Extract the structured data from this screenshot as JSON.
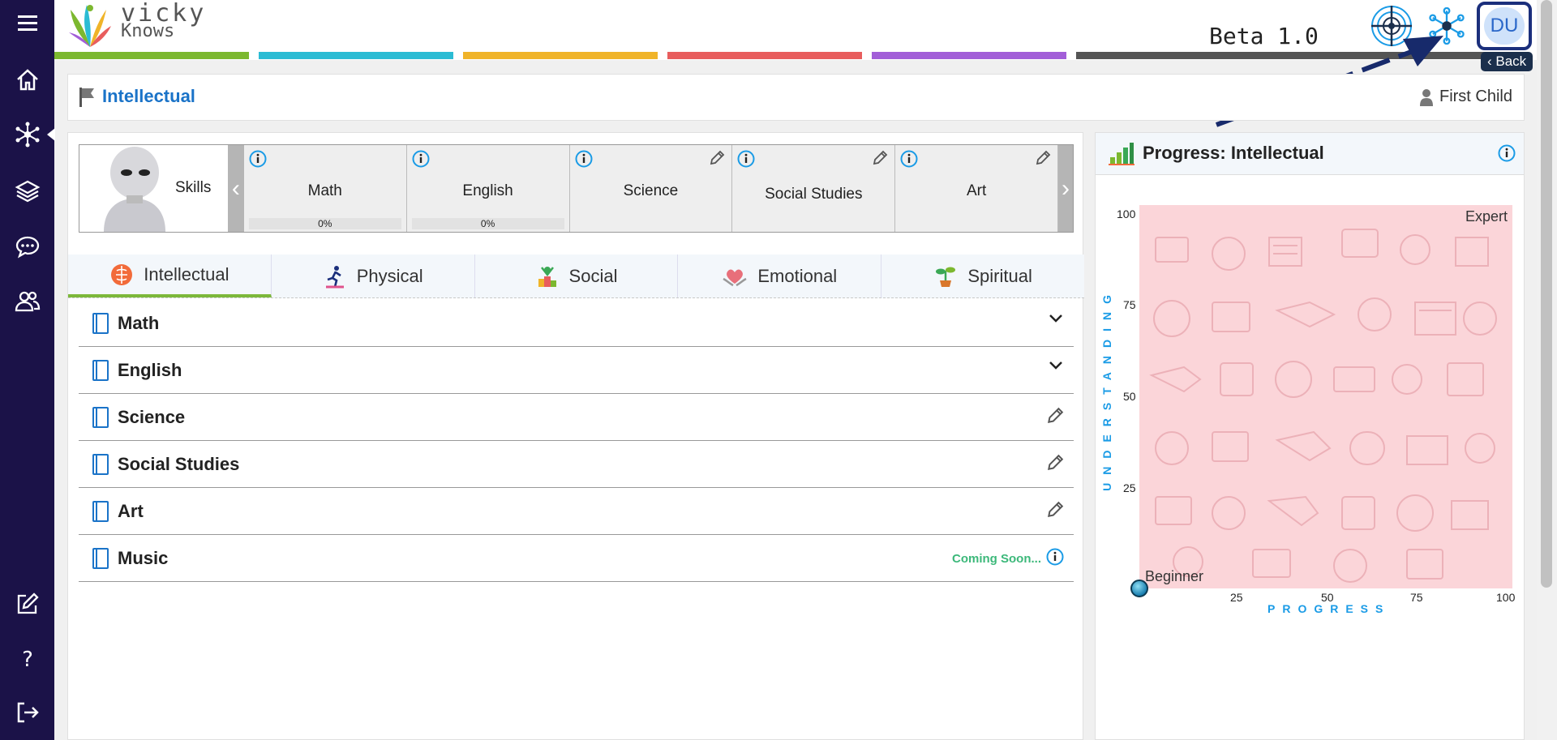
{
  "app": {
    "logo_line1": "vicky",
    "logo_line2": "Knows",
    "version": "Beta 1.0",
    "user_initials": "DU",
    "back_label": "Back"
  },
  "colors": {
    "sidebar": "#1b1248",
    "accent_blue": "#1a73c8",
    "strip": [
      "#7cb82f",
      "#2bbcd4",
      "#f0b429",
      "#e85d5d",
      "#a25ed8",
      "#555555"
    ]
  },
  "sidebar": {
    "items": [
      {
        "icon": "menu-icon"
      },
      {
        "icon": "home-icon"
      },
      {
        "icon": "network-icon"
      },
      {
        "icon": "layers-icon"
      },
      {
        "icon": "chat-icon"
      },
      {
        "icon": "users-icon"
      },
      {
        "icon": "edit-icon"
      },
      {
        "icon": "help-icon"
      },
      {
        "icon": "logout-icon"
      }
    ]
  },
  "titlebar": {
    "title": "Intellectual",
    "child_name": "First Child"
  },
  "skills": {
    "label": "Skills",
    "cards": [
      {
        "name": "Math",
        "progress": "0%",
        "has_info": true,
        "has_edit": false
      },
      {
        "name": "English",
        "progress": "0%",
        "has_info": true,
        "has_edit": false
      },
      {
        "name": "Science",
        "progress": "",
        "has_info": true,
        "has_edit": true
      },
      {
        "name": "Social Studies",
        "progress": "",
        "has_info": true,
        "has_edit": true
      },
      {
        "name": "Art",
        "progress": "",
        "has_info": true,
        "has_edit": true
      }
    ]
  },
  "tabs": [
    {
      "label": "Intellectual",
      "active": true
    },
    {
      "label": "Physical",
      "active": false
    },
    {
      "label": "Social",
      "active": false
    },
    {
      "label": "Emotional",
      "active": false
    },
    {
      "label": "Spiritual",
      "active": false
    }
  ],
  "subjects": [
    {
      "name": "Math",
      "action": "expand"
    },
    {
      "name": "English",
      "action": "expand"
    },
    {
      "name": "Science",
      "action": "edit"
    },
    {
      "name": "Social Studies",
      "action": "edit"
    },
    {
      "name": "Art",
      "action": "edit"
    },
    {
      "name": "Music",
      "action": "soon",
      "soon_label": "Coming Soon..."
    }
  ],
  "progress": {
    "title": "Progress: Intellectual",
    "expert_label": "Expert",
    "beginner_label": "Beginner",
    "x_axis_label": "PROGRESS",
    "y_axis_label": "UNDERSTANDING",
    "x_ticks": [
      "25",
      "50",
      "75",
      "100"
    ],
    "y_ticks": [
      "100",
      "75",
      "50",
      "25"
    ],
    "point": {
      "progress": 0,
      "understanding": 0
    }
  }
}
